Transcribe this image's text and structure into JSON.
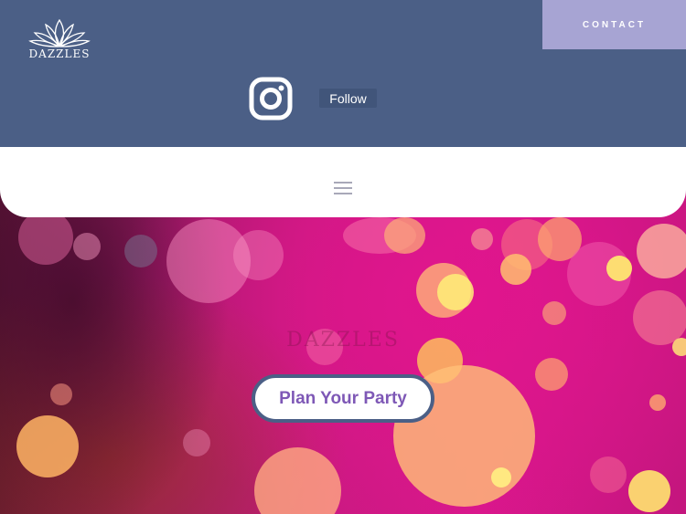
{
  "header": {
    "brand": "DAZZLES",
    "contact_label": "CONTACT",
    "follow_label": "Follow",
    "social_icon": "instagram-icon",
    "menu_icon": "hamburger-menu-icon"
  },
  "hero": {
    "watermark": "DAZZLES",
    "cta_label": "Plan Your Party"
  },
  "colors": {
    "header_bg": "#4b5f86",
    "contact_bg": "#a7a4d3",
    "cta_text": "#7e58b6",
    "hero_magenta": "#d9178c"
  }
}
